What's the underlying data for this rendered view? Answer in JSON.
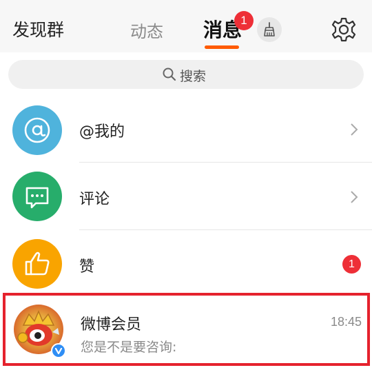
{
  "header": {
    "discover_label": "发现群",
    "tabs": [
      {
        "label": "动态",
        "active": false
      },
      {
        "label": "消息",
        "active": true,
        "badge": "1"
      }
    ],
    "broom_icon": "broom-icon",
    "settings_icon": "gear-icon",
    "accent_color": "#ff5a00"
  },
  "search": {
    "placeholder": "搜索",
    "icon": "search-icon"
  },
  "rows": [
    {
      "label": "@我的",
      "icon": "at-icon",
      "color": "#4fb3dc",
      "chevron": true
    },
    {
      "label": "评论",
      "icon": "comment-icon",
      "color": "#27ad6b",
      "chevron": true
    },
    {
      "label": "赞",
      "icon": "thumbs-up-icon",
      "color": "#f9a400",
      "badge": "1"
    }
  ],
  "conversation": {
    "name": "微博会员",
    "time": "18:45",
    "preview": "您是不是要咨询:",
    "verified_icon": "verified-badge-icon",
    "highlight_color": "#e5222d"
  }
}
